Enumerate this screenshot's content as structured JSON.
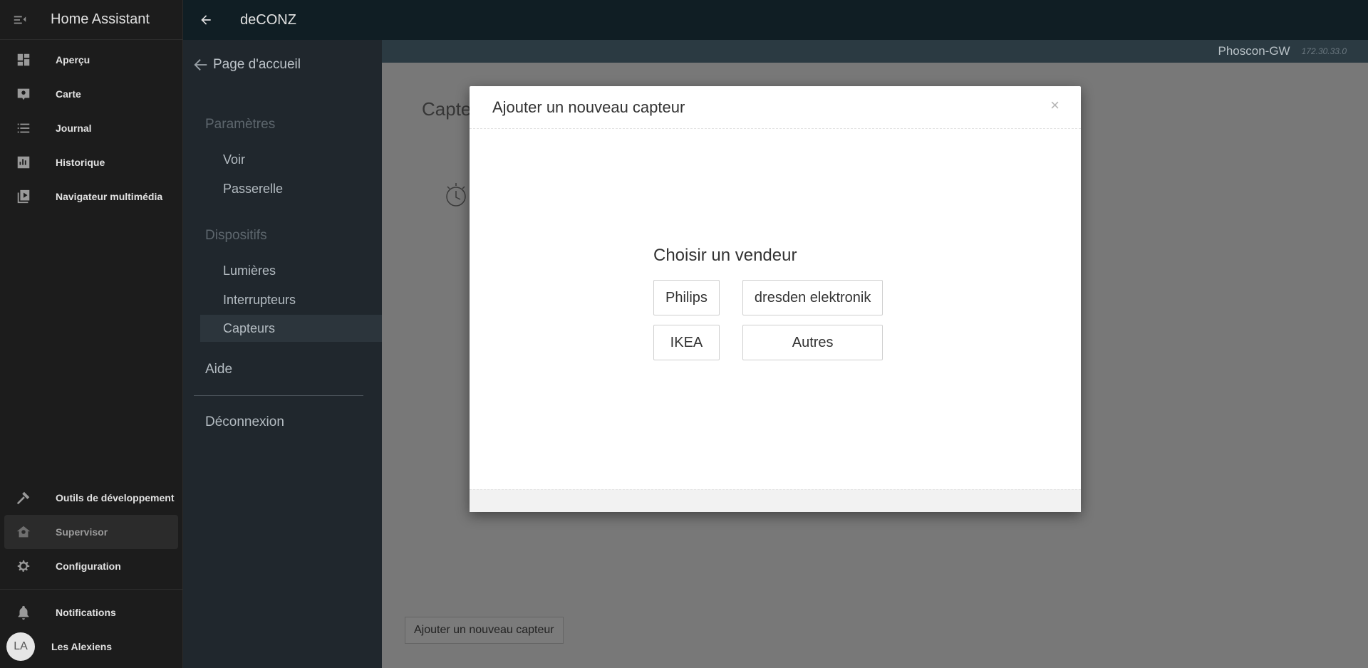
{
  "app": {
    "title": "Home Assistant"
  },
  "sidebar": {
    "items": [
      {
        "label": "Aperçu",
        "icon": "dashboard-icon"
      },
      {
        "label": "Carte",
        "icon": "map-icon"
      },
      {
        "label": "Journal",
        "icon": "list-icon"
      },
      {
        "label": "Historique",
        "icon": "chart-icon"
      },
      {
        "label": "Navigateur multimédia",
        "icon": "media-icon"
      }
    ],
    "bottom": {
      "dev_tools": "Outils de développement",
      "supervisor": "Supervisor",
      "configuration": "Configuration",
      "notifications": "Notifications",
      "user_name": "Les Alexiens",
      "user_initials": "LA"
    }
  },
  "toolbar": {
    "title": "deCONZ"
  },
  "phoscon": {
    "home": "Page d'accueil",
    "sections": {
      "parametres": "Paramètres",
      "voir": "Voir",
      "passerelle": "Passerelle",
      "dispositifs": "Dispositifs",
      "lumieres": "Lumières",
      "interrupteurs": "Interrupteurs",
      "capteurs": "Capteurs",
      "aide": "Aide",
      "deconnexion": "Déconnexion"
    },
    "gateway": {
      "name": "Phoscon-GW",
      "ip": "172.30.33.0"
    },
    "content_title": "Capteurs",
    "add_button": "Ajouter un nouveau capteur"
  },
  "modal": {
    "title": "Ajouter un nouveau capteur",
    "close": "×",
    "vendor_heading": "Choisir un vendeur",
    "vendors": [
      "Philips",
      "dresden elektronik",
      "IKEA",
      "Autres"
    ]
  },
  "colors": {
    "sidebar_bg": "#1c1c1c",
    "toolbar_bg": "#101e24",
    "phoscon_menu_bg": "#20272d",
    "gateway_bar": "#2b3a42"
  }
}
